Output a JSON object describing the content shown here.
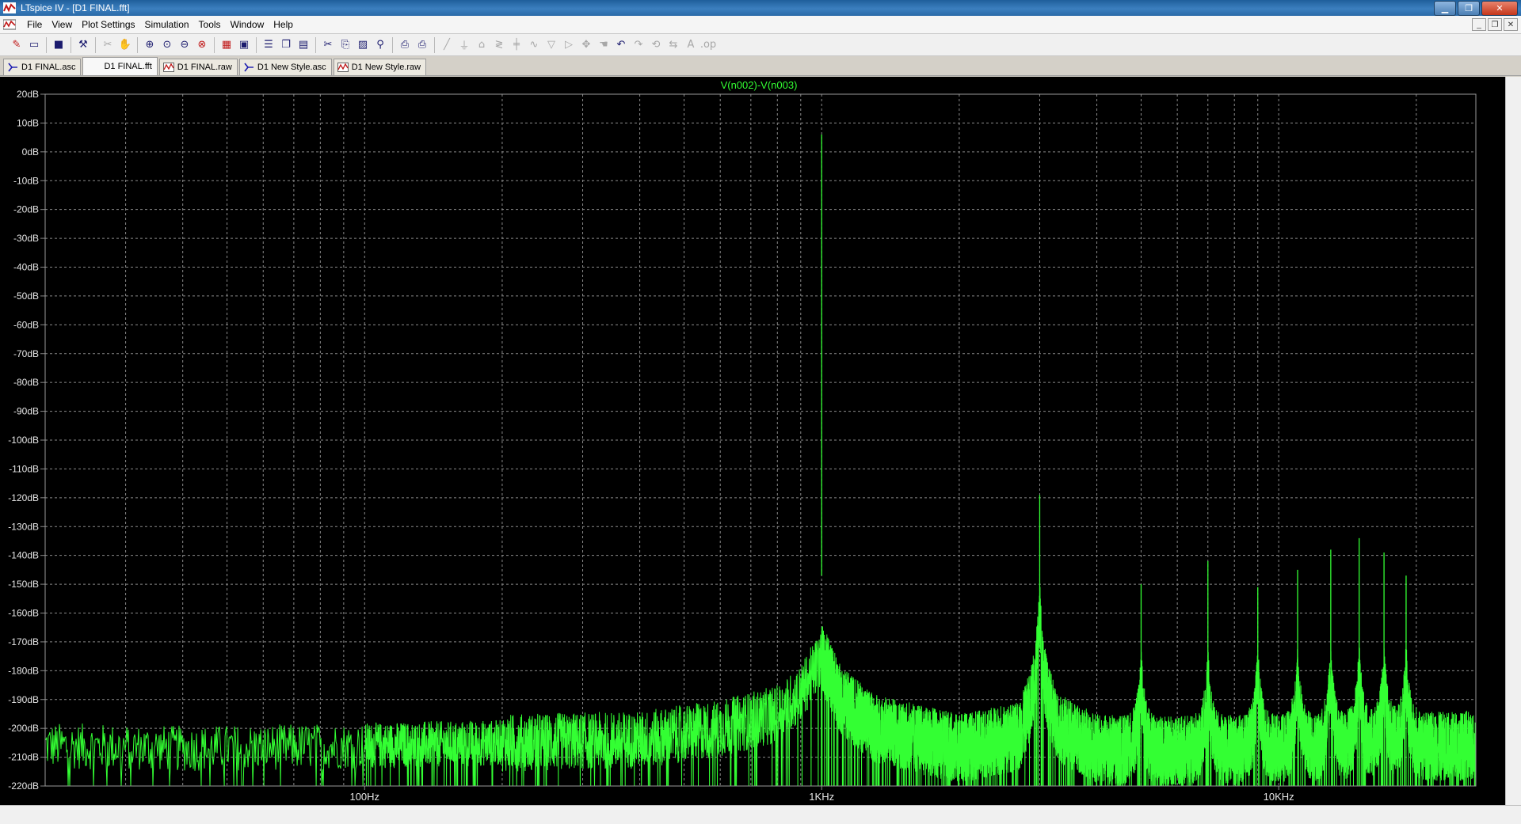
{
  "window": {
    "title": "LTspice IV - [D1 FINAL.fft]"
  },
  "menu": [
    "File",
    "View",
    "Plot Settings",
    "Simulation",
    "Tools",
    "Window",
    "Help"
  ],
  "tabs": [
    {
      "label": "D1 FINAL.asc",
      "icon": "schematic-icon",
      "active": false
    },
    {
      "label": "D1 FINAL.fft",
      "icon": "",
      "active": true
    },
    {
      "label": "D1 FINAL.raw",
      "icon": "waveform-icon",
      "active": false
    },
    {
      "label": "D1 New Style.asc",
      "icon": "schematic-icon",
      "active": false
    },
    {
      "label": "D1 New Style.raw",
      "icon": "waveform-icon",
      "active": false
    }
  ],
  "colors": {
    "plot_background": "#000000",
    "trace": "#33ff33",
    "grid": "#8a8a8a",
    "axis_text": "#e6e6e6"
  },
  "chart_data": {
    "type": "line",
    "trace_label": "V(n002)-V(n003)",
    "x_scale": "log",
    "xlim": [
      20,
      27000
    ],
    "ylim": [
      -220,
      20
    ],
    "x_unit": "Hz",
    "y_unit": "dB",
    "grid": true,
    "y_ticks": [
      "20dB",
      "10dB",
      "0dB",
      "-10dB",
      "-20dB",
      "-30dB",
      "-40dB",
      "-50dB",
      "-60dB",
      "-70dB",
      "-80dB",
      "-90dB",
      "-100dB",
      "-110dB",
      "-120dB",
      "-130dB",
      "-140dB",
      "-150dB",
      "-160dB",
      "-170dB",
      "-180dB",
      "-190dB",
      "-200dB",
      "-210dB",
      "-220dB"
    ],
    "x_ticks": [
      "100Hz",
      "1KHz",
      "10KHz"
    ],
    "noise_floor": [
      [
        20,
        -206
      ],
      [
        40,
        -207
      ],
      [
        100,
        -206
      ],
      [
        200,
        -205
      ],
      [
        400,
        -204
      ],
      [
        600,
        -200
      ],
      [
        800,
        -195
      ],
      [
        900,
        -188
      ],
      [
        1000,
        -175
      ],
      [
        1100,
        -190
      ],
      [
        1300,
        -200
      ],
      [
        2000,
        -207
      ],
      [
        2700,
        -203
      ],
      [
        3000,
        -185
      ],
      [
        3300,
        -200
      ],
      [
        4000,
        -207
      ],
      [
        5000,
        -208
      ],
      [
        27000,
        -206
      ]
    ],
    "peaks": [
      {
        "freq": 1000,
        "db": 6
      },
      {
        "freq": 3000,
        "db": -119
      },
      {
        "freq": 5000,
        "db": -150
      },
      {
        "freq": 7000,
        "db": -142
      },
      {
        "freq": 9000,
        "db": -151
      },
      {
        "freq": 11000,
        "db": -145
      },
      {
        "freq": 13000,
        "db": -138
      },
      {
        "freq": 15000,
        "db": -134
      },
      {
        "freq": 17000,
        "db": -139
      },
      {
        "freq": 19000,
        "db": -147
      }
    ]
  }
}
